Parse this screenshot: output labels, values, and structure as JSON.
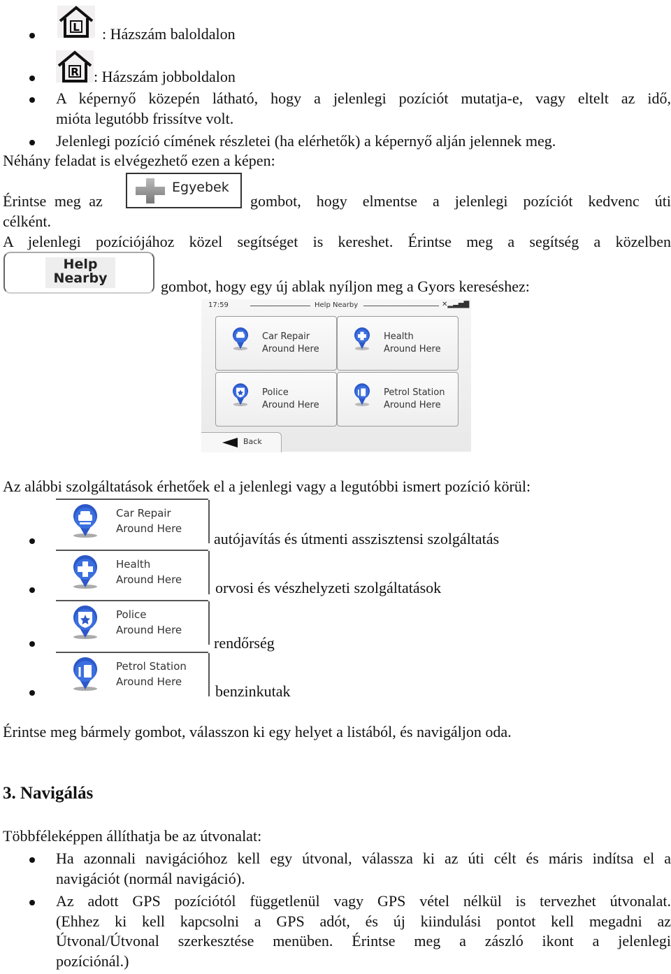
{
  "list_top": [
    {
      "icon": "house-left-icon",
      "icon_letter": "L",
      "text": ": Házszám baloldalon"
    },
    {
      "icon": "house-right-icon",
      "icon_letter": "R",
      "text": ": Házszám jobboldalon"
    }
  ],
  "bullet3": {
    "line1": "A képernyő közepén látható, hogy a jelenlegi pozíciót mutatja-e, vagy eltelt az idő,",
    "line2": "mióta legutóbb frissítve volt."
  },
  "bullet4": "Jelenlegi pozíció címének részletei (ha elérhetők) a képernyő alján jelennek meg.",
  "para_tasks": "Néhány feladat is elvégezhető ezen a képen:",
  "para_egyebek": {
    "before": "Érintse meg az",
    "button_label": "Egyebek",
    "after": "gombot, hogy elmentse a jelenlegi pozíciót kedvenc úti",
    "line2": "célként."
  },
  "para_help": {
    "line1": "A jelenlegi pozíciójához közel segítséget is kereshet. Érintse meg a segítség a közelben",
    "button_line1": "Help",
    "button_line2": "Nearby",
    "after": "gombot, hogy egy új ablak nyíljon meg a Gyors kereséshez:"
  },
  "device_screen": {
    "time": "17:59",
    "title": "Help Nearby",
    "tiles": [
      {
        "icon": "car-repair-icon",
        "line1": "Car Repair",
        "line2": "Around Here"
      },
      {
        "icon": "health-icon",
        "line1": "Health",
        "line2": "Around Here"
      },
      {
        "icon": "police-icon",
        "line1": "Police",
        "line2": "Around Here"
      },
      {
        "icon": "petrol-station-icon",
        "line1": "Petrol Station",
        "line2": "Around Here"
      }
    ],
    "back_label": "Back"
  },
  "para_services": "Az alábbi szolgáltatások érhetőek el a jelenlegi vagy a legutóbbi ismert pozíció körül:",
  "services": [
    {
      "icon": "car-repair-icon",
      "line1": "Car Repair",
      "line2": "Around Here",
      "text": "autójavítás és útmenti asszisztensi szolgáltatás"
    },
    {
      "icon": "health-icon",
      "line1": "Health",
      "line2": "Around Here",
      "text": "orvosi és vészhelyzeti szolgáltatások"
    },
    {
      "icon": "police-icon",
      "line1": "Police",
      "line2": "Around Here",
      "text": "rendőrség"
    },
    {
      "icon": "petrol-station-icon",
      "line1": "Petrol Station",
      "line2": "Around Here",
      "text": "benzinkutak"
    }
  ],
  "para_touch": "Érintse meg bármely gombot, válasszon ki egy helyet a listából, és navigáljon oda.",
  "section_heading": "3. Navigálás",
  "para_route": "Többféleképpen állíthatja be az útvonalat:",
  "nav_bullets": [
    {
      "lines": [
        "Ha azonnali navigációhoz kell egy útvonal, válassza ki az úti célt és máris indítsa el a",
        "navigációt (normál navigáció)."
      ]
    },
    {
      "lines": [
        "Az adott GPS pozíciótól függetlenül vagy GPS vétel nélkül is tervezhet útvonalat.",
        "(Ehhez ki kell kapcsolni a GPS adót, és új kiindulási pontot kell megadni az",
        "Útvonal/Útvonal szerkesztése menüben. Érintse meg a zászló ikont a jelenlegi",
        "pozíciónál.)"
      ]
    }
  ]
}
